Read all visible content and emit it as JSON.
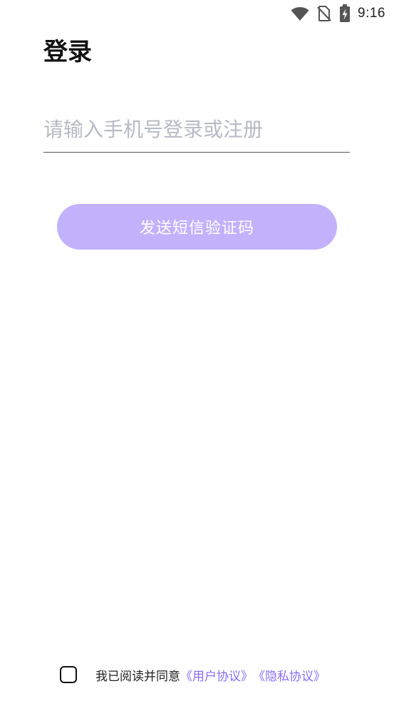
{
  "status_bar": {
    "time": "9:16",
    "icons": [
      "wifi-icon",
      "no-sim-icon",
      "battery-charging-icon"
    ]
  },
  "page": {
    "title": "登录"
  },
  "phone_input": {
    "value": "",
    "placeholder": "请输入手机号登录或注册"
  },
  "send_button": {
    "label": "发送短信验证码"
  },
  "agreement": {
    "checked": false,
    "prefix": "我已阅读并同意",
    "user_agreement": "《用户协议》",
    "privacy_policy": "《隐私协议》"
  },
  "colors": {
    "primary_disabled": "#c3b1fc",
    "link": "#8b6cf3",
    "placeholder": "#b6bac4"
  }
}
